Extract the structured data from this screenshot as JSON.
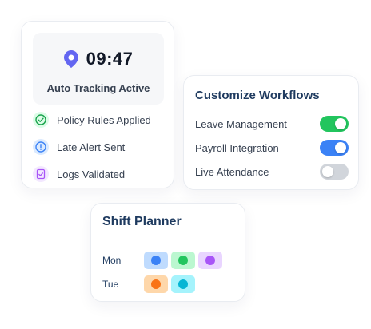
{
  "tracking": {
    "time": "09:47",
    "status": "Auto Tracking Active",
    "pin_icon": "map-pin-icon",
    "items": [
      {
        "label": "Policy Rules Applied",
        "icon": "check-circle-icon",
        "color": "#16a34a",
        "bg": "#dcfce7"
      },
      {
        "label": "Late Alert Sent",
        "icon": "alert-circle-icon",
        "color": "#3b82f6",
        "bg": "#dbeafe"
      },
      {
        "label": "Logs Validated",
        "icon": "document-check-icon",
        "color": "#a855f7",
        "bg": "#f3e8ff"
      }
    ]
  },
  "workflows": {
    "title": "Customize Workflows",
    "items": [
      {
        "label": "Leave Management",
        "on": true,
        "color": "#22c55e"
      },
      {
        "label": "Payroll Integration",
        "on": true,
        "color": "#3b82f6"
      },
      {
        "label": "Live Attendance",
        "on": false,
        "color": "#d1d5db"
      }
    ]
  },
  "shift": {
    "title": "Shift Planner",
    "rows": [
      {
        "day": "Mon",
        "slots": [
          {
            "bg": "#bfdbfe",
            "dot": "#3b82f6"
          },
          {
            "bg": "#bbf7d0",
            "dot": "#22c55e"
          },
          {
            "bg": "#e9d5ff",
            "dot": "#a855f7"
          }
        ]
      },
      {
        "day": "Tue",
        "slots": [
          {
            "bg": "#fed7aa",
            "dot": "#f97316"
          },
          {
            "bg": "#a5f3fc",
            "dot": "#06b6d4"
          }
        ]
      }
    ]
  },
  "colors": {
    "accent": "#6366f1",
    "heading": "#1e3a5f"
  }
}
